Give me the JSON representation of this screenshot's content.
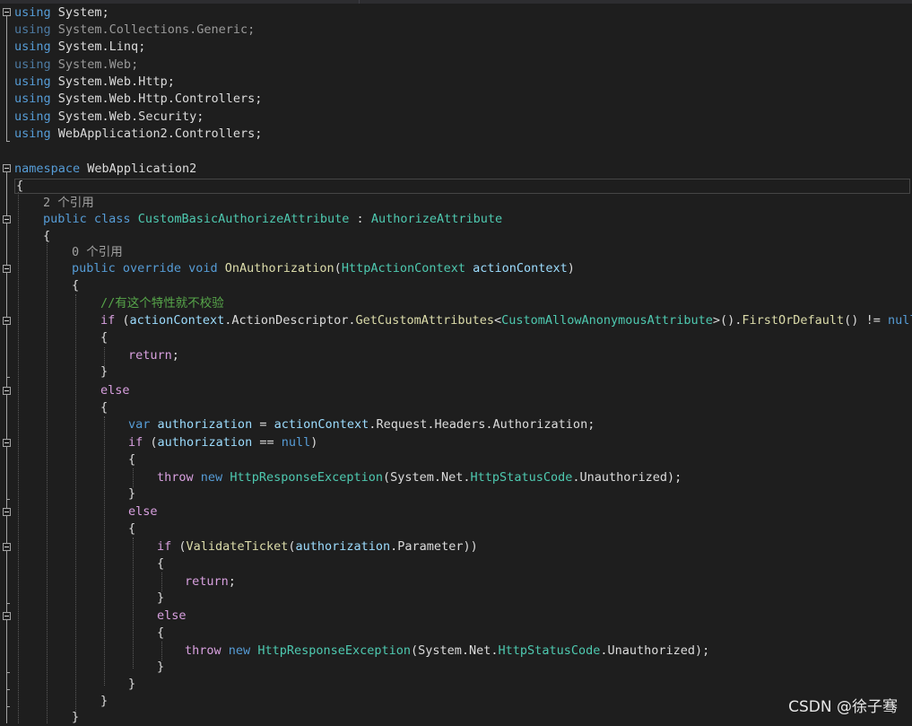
{
  "code": {
    "usings": [
      {
        "keyword": "using",
        "namespace": "System",
        "end": ";"
      },
      {
        "keyword": "using",
        "namespace": "System.Collections.Generic",
        "end": ";"
      },
      {
        "keyword": "using",
        "namespace": "System.Linq",
        "end": ";"
      },
      {
        "keyword": "using",
        "namespace": "System.Web",
        "end": ";"
      },
      {
        "keyword": "using",
        "namespace": "System.Web.Http",
        "end": ";"
      },
      {
        "keyword": "using",
        "namespace": "System.Web.Http.Controllers",
        "end": ";"
      },
      {
        "keyword": "using",
        "namespace": "System.Web.Security",
        "end": ";"
      },
      {
        "keyword": "using",
        "namespace": "WebApplication2.Controllers",
        "end": ";"
      }
    ],
    "namespace_kw": "namespace",
    "namespace_name": "WebApplication2",
    "open_brace": "{",
    "close_brace": "}",
    "class_refs": "2 个引用",
    "kw_public": "public",
    "kw_class": "class",
    "class_name": "CustomBasicAuthorizeAttribute",
    "colon": ":",
    "base_class": "AuthorizeAttribute",
    "method_refs": "0 个引用",
    "kw_override": "override",
    "kw_void": "void",
    "method_name": "OnAuthorization",
    "open_paren": "(",
    "close_paren": ")",
    "param_type": "HttpActionContext",
    "param_name": "actionContext",
    "comment": "//有这个特性就不校验",
    "kw_if": "if",
    "kw_else": "else",
    "kw_return": "return",
    "kw_var": "var",
    "kw_throw": "throw",
    "kw_new": "new",
    "kw_null": "null",
    "semicolon": ";",
    "dot": ".",
    "eq_op": "==",
    "neq_op": "!=",
    "assign_op": "=",
    "lt": "<",
    "gt": ">",
    "empty_parens": "()",
    "action_descriptor": "ActionDescriptor",
    "get_custom_attributes": "GetCustomAttributes",
    "allow_anon_type": "CustomAllowAnonymousAttribute",
    "first_or_default": "FirstOrDefault",
    "authorization_var": "authorization",
    "request": "Request",
    "headers": "Headers",
    "authorization_prop": "Authorization",
    "http_response_exception": "HttpResponseException",
    "system_net": "System.Net.",
    "http_status_code": "HttpStatusCode",
    "unauthorized": "Unauthorized",
    "validate_ticket": "ValidateTicket",
    "parameter": "Parameter"
  },
  "watermark": "CSDN @徐子骞"
}
